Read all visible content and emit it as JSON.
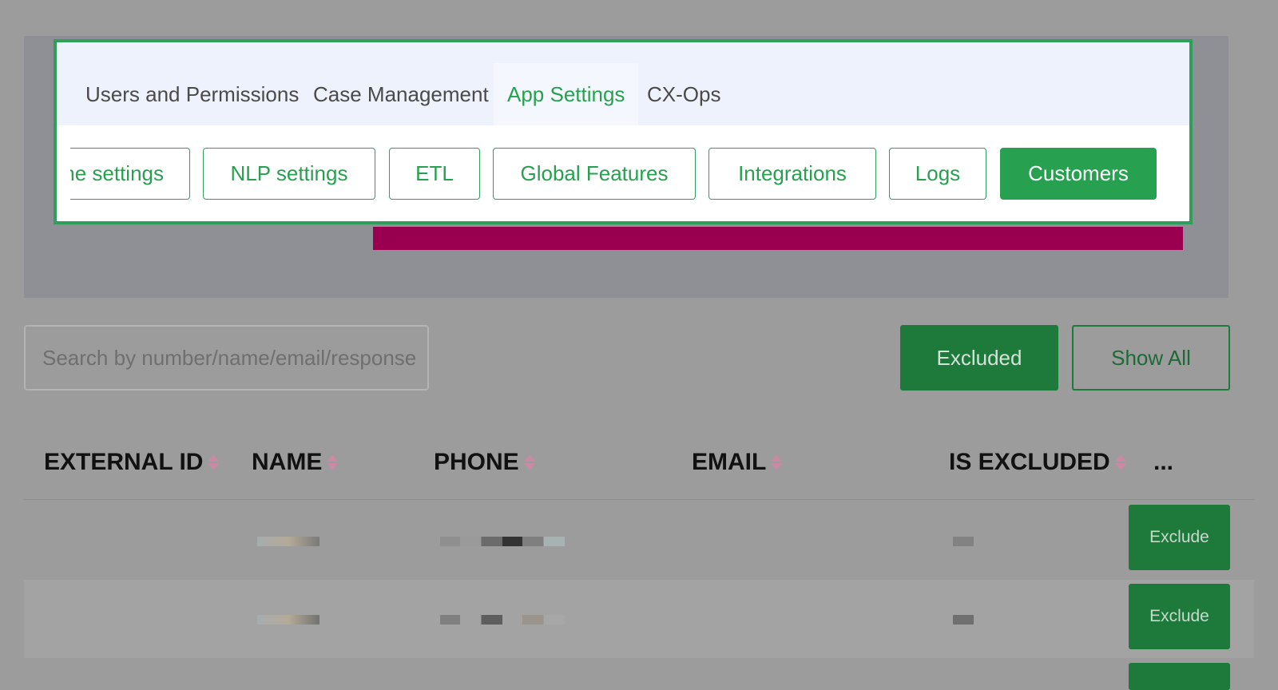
{
  "tabs": [
    {
      "label": "Users and Permissions"
    },
    {
      "label": "Case Management"
    },
    {
      "label": "App Settings"
    },
    {
      "label": "CX-Ops"
    }
  ],
  "subnav": [
    {
      "label": "ne settings"
    },
    {
      "label": "NLP settings"
    },
    {
      "label": "ETL"
    },
    {
      "label": "Global Features"
    },
    {
      "label": "Integrations"
    },
    {
      "label": "Logs"
    },
    {
      "label": "Customers"
    }
  ],
  "search": {
    "placeholder": "Search by number/name/email/response"
  },
  "filters": {
    "excluded": "Excluded",
    "show_all": "Show All"
  },
  "table": {
    "columns": [
      "EXTERNAL ID",
      "NAME",
      "PHONE",
      "EMAIL",
      "IS EXCLUDED",
      "..."
    ],
    "row_action": "Exclude"
  },
  "colors": {
    "accent": "#27a150",
    "accent_dark": "#1d7a3b",
    "highlight_bar": "#98004f"
  }
}
